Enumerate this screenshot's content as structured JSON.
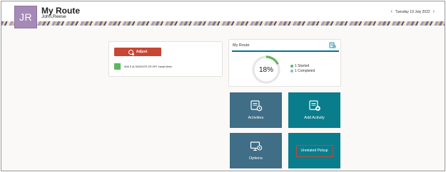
{
  "header": {
    "avatar_initials": "JR",
    "title": "My Route",
    "user_name": "John,Reese",
    "date": "Tuesday 19 July 2022",
    "prev_icon": "chevron-left-icon",
    "next_icon": "chevron-right-icon"
  },
  "activity_card": {
    "adjust_label": "Adjust",
    "adjust_icon": "adjust-icon",
    "activity_text": "i606 E ALTAMONTE DR ERT Install Meter",
    "activity_color": "#5cb85c"
  },
  "route_card": {
    "title": "My Route",
    "icon": "route-map-icon",
    "progress_percent": 18,
    "progress_label": "18%",
    "legend": [
      {
        "label": "1 Started",
        "color": "#5cb85c"
      },
      {
        "label": "1 Completed",
        "color": "#8fb3cf"
      }
    ]
  },
  "tiles": {
    "activities": {
      "label": "Activities",
      "icon": "activities-icon",
      "color": "#3f6e86"
    },
    "add_activity": {
      "label": "Add Activity",
      "icon": "add-activity-icon",
      "color": "#0a7d8c"
    },
    "options": {
      "label": "Options",
      "icon": "options-icon",
      "color": "#3f6e86"
    },
    "unrelated_pickup": {
      "label": "Unrelated Pickup",
      "color": "#0a7d8c"
    }
  }
}
